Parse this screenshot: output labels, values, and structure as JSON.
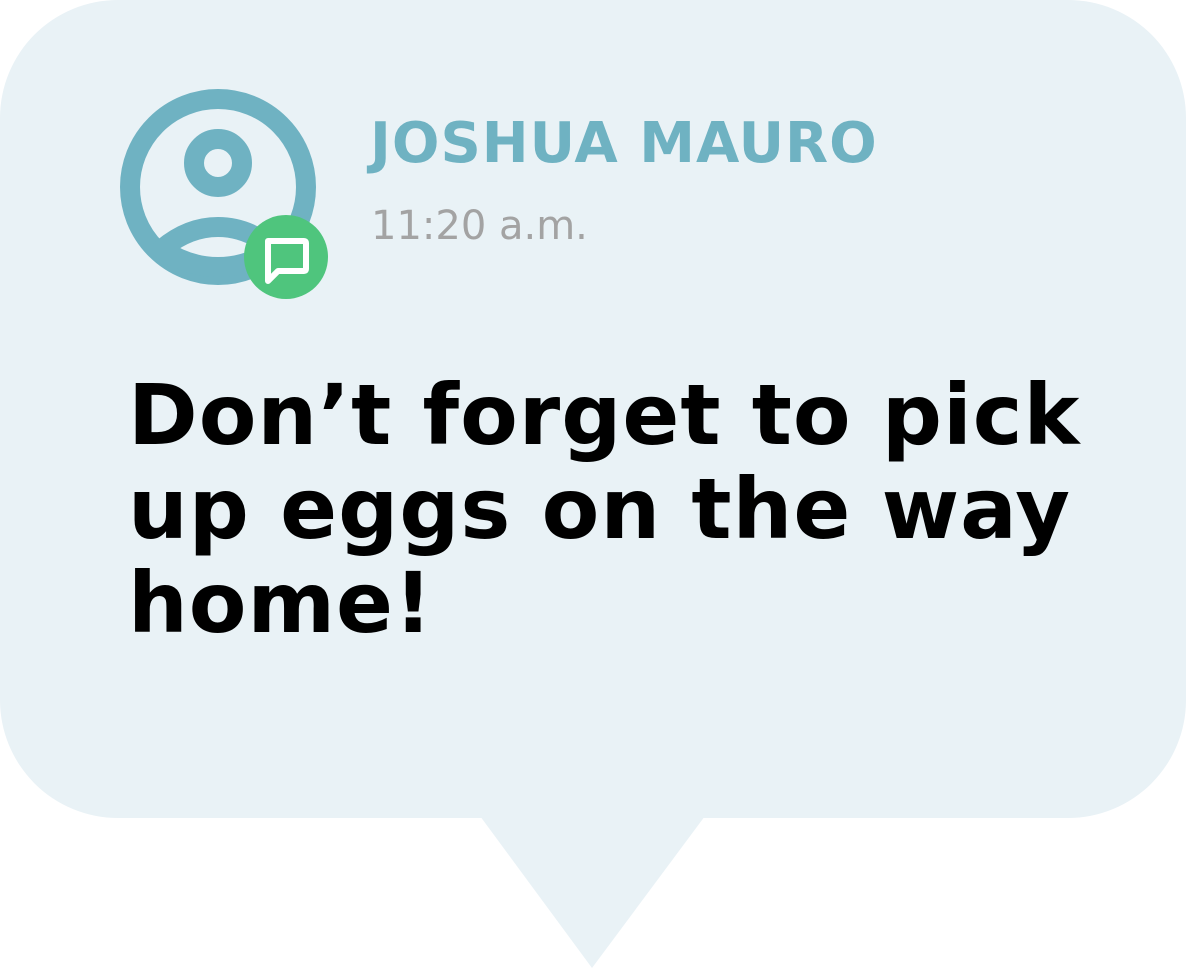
{
  "notification": {
    "sender_name": "JOSHUA MAURO",
    "time": "11:20 a.m.",
    "message": "Don’t forget to pick up eggs on the way home!",
    "avatar_icon": "user-circle-icon",
    "badge_icon": "chat-bubble-icon"
  },
  "colors": {
    "bubble_background": "#e9f2f6",
    "accent": "#6fb2c2",
    "badge": "#4fc57d",
    "timestamp": "#a3a3a3",
    "message_text": "#000000"
  }
}
